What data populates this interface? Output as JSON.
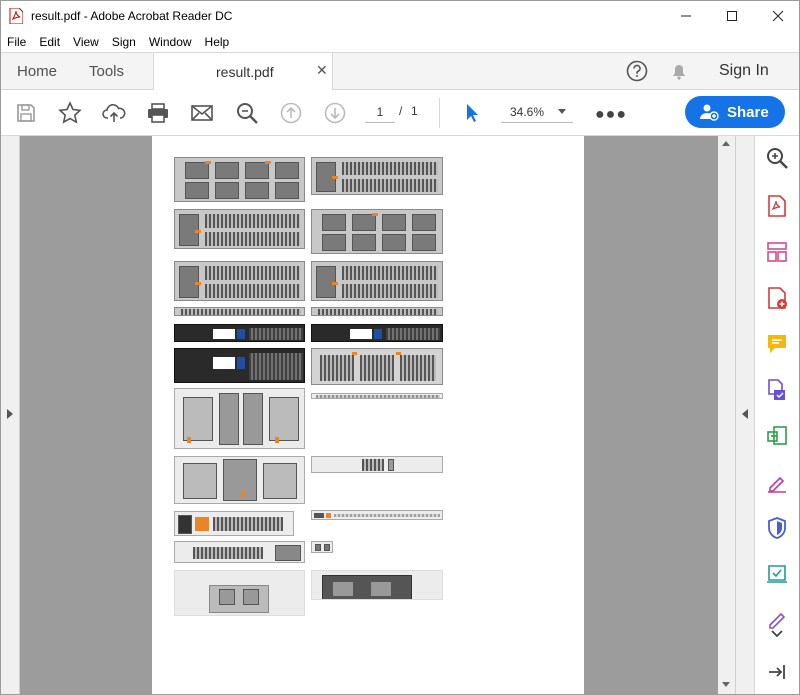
{
  "window": {
    "title": "result.pdf - Adobe Acrobat Reader DC",
    "controls": [
      "minimize",
      "maximize",
      "close"
    ]
  },
  "menu": [
    "File",
    "Edit",
    "View",
    "Sign",
    "Window",
    "Help"
  ],
  "tabs": {
    "home": "Home",
    "tools": "Tools",
    "document": "result.pdf"
  },
  "header": {
    "sign_in": "Sign In"
  },
  "toolbar": {
    "current_page": "1",
    "page_separator": "/",
    "total_pages": "1",
    "zoom": "34.6%",
    "share_label": "Share"
  },
  "icons": {
    "toolbar": [
      "save-icon",
      "star-icon",
      "upload-icon",
      "print-icon",
      "email-icon",
      "zoom-search-icon",
      "page-up-icon",
      "page-down-icon",
      "select-cursor-icon",
      "more-icon"
    ],
    "tools_pane": [
      "zoom-in-icon",
      "create-pdf-icon",
      "organize-pages-icon",
      "export-pdf-icon",
      "comment-icon",
      "combine-files-icon",
      "compress-pdf-icon",
      "fill-sign-icon",
      "protect-icon",
      "send-for-review-icon",
      "edit-pdf-icon",
      "collapse-pane-icon"
    ]
  },
  "colors": {
    "accent": "#1473e6",
    "doc_background": "#9c9c9c",
    "orange": "#e8852a"
  }
}
